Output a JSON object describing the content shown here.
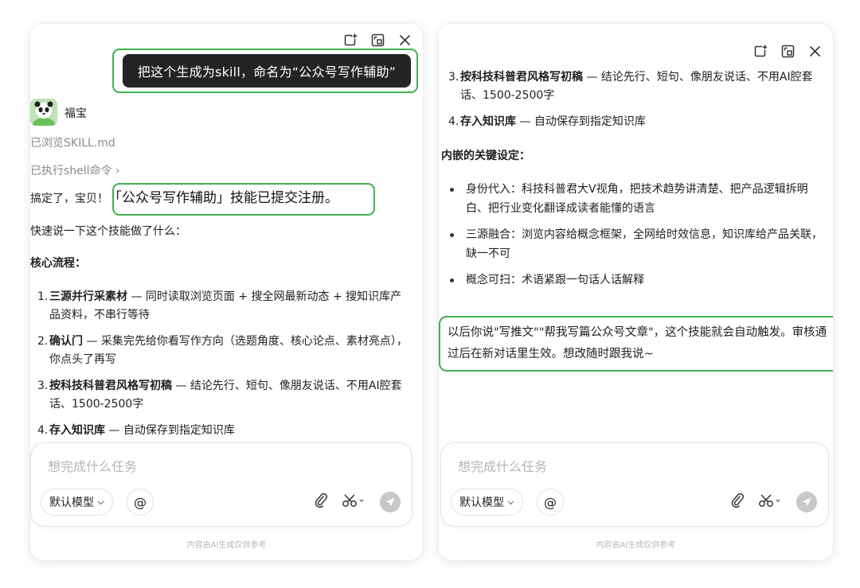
{
  "left_panel": {
    "user_message": "把这个生成为skill，命名为“公众号写作辅助”",
    "bot_name": "福宝",
    "tool_browse": "已浏览SKILL.md",
    "tool_shell": "已执行shell命令 ›",
    "reply_prefix": "搞定了，宝贝！",
    "reply_highlight": "「公众号写作辅助」技能已提交注册。",
    "reply_intro": "快速说一下这个技能做了什么：",
    "core_flow_title": "核心流程：",
    "steps": [
      {
        "num": "1.",
        "bold": "三源并行采素材",
        "text": " — 同时读取浏览页面 + 搜全网最新动态 + 搜知识库产品资料，不串行等待"
      },
      {
        "num": "2.",
        "bold": "确认门",
        "text": " — 采集完先给你看写作方向（选题角度、核心论点、素材亮点），你点头了再写"
      },
      {
        "num": "3.",
        "bold": "按科技科普君风格写初稿",
        "text": " — 结论先行、短句、像朋友说话、不用AI腔套话、1500-2500字"
      },
      {
        "num": "4.",
        "bold": "存入知识库",
        "text": " — 自动保存到指定知识库"
      }
    ]
  },
  "right_panel": {
    "steps": [
      {
        "num": "3.",
        "bold": "按科技科普君风格写初稿",
        "text": " — 结论先行、短句、像朋友说话、不用AI腔套话、1500-2500字"
      },
      {
        "num": "4.",
        "bold": "存入知识库",
        "text": " — 自动保存到指定知识库"
      }
    ],
    "key_settings_title": "内嵌的关键设定：",
    "bullets": [
      "身份代入：科技科普君大V视角，把技术趋势讲清楚、把产品逻辑拆明白、把行业变化翻译成读者能懂的语言",
      "三源融合：浏览内容给概念框架，全网给时效信息，知识库给产品关联，缺一不可",
      "概念可扫：术语紧跟一句话人话解释"
    ],
    "closing": "以后你说\"写推文\"\"帮我写篇公众号文章\"，这个技能就会自动触发。审核通过后在新对话里生效。想改随时跟我说~"
  },
  "composer": {
    "placeholder": "想完成什么任务",
    "model_label": "默认模型",
    "at_label": "@"
  },
  "footnote": "内容由AI生成仅供参考",
  "colors": {
    "highlight_border": "#3fb34f",
    "user_bubble_bg": "#242424",
    "send_button": "#c8c8c8"
  },
  "icons": {
    "window": [
      "new-chat-icon",
      "expand-window-icon",
      "close-icon"
    ],
    "composer": [
      "paperclip-icon",
      "scissors-icon",
      "send-icon"
    ]
  }
}
